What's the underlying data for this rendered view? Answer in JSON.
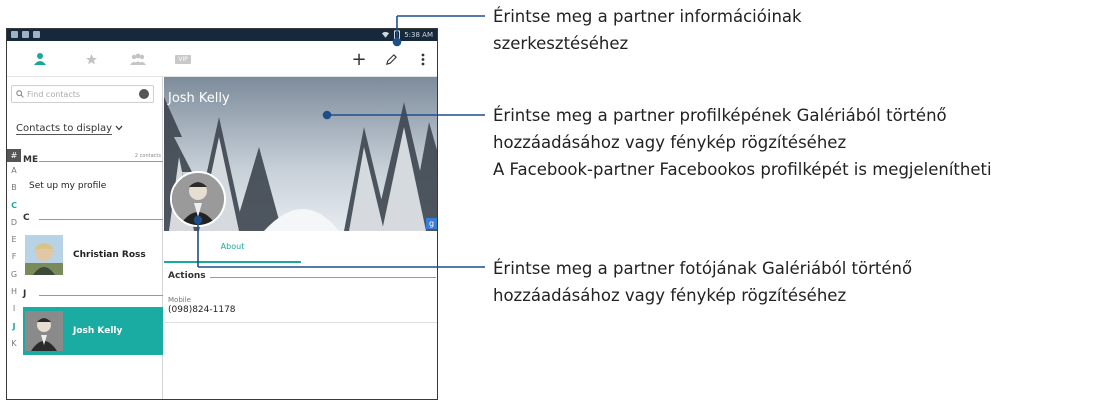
{
  "status_bar": {
    "time": "5:38 AM"
  },
  "toolbar": {
    "tabs": [
      {
        "icon": "person-icon",
        "selected": true
      },
      {
        "icon": "star-icon",
        "selected": false
      },
      {
        "icon": "group-icon",
        "selected": false
      },
      {
        "icon": "vip-icon",
        "label": "VIP",
        "selected": false
      }
    ],
    "add_label": "+",
    "accent_color": "#1aa7a0"
  },
  "left_pane": {
    "search_placeholder": "Find contacts",
    "contacts_to_display": "Contacts to display",
    "index_letters": [
      "#",
      "A",
      "B",
      "C",
      "D",
      "E",
      "F",
      "G",
      "H",
      "I",
      "J",
      "K"
    ],
    "highlighted_letters": [
      "C",
      "J"
    ],
    "sections": [
      {
        "letter": "ME",
        "count_label": "2 contacts"
      },
      {
        "letter": "C"
      },
      {
        "letter": "J"
      }
    ],
    "items": [
      {
        "name": "Set up my profile"
      },
      {
        "name": "Christian Ross"
      },
      {
        "name": "Josh Kelly",
        "selected": true
      }
    ]
  },
  "detail": {
    "contact_name": "Josh Kelly",
    "tab_about": "About",
    "actions_title": "Actions",
    "phone_label": "Mobile",
    "phone_value": "(098)824-1178",
    "source_badge": "g"
  },
  "callouts": {
    "edit": {
      "line1": "Érintse meg a partner információinak",
      "line2": "szerkesztéséhez"
    },
    "cover": {
      "line1": "Érintse meg a partner profilképének Galériából történő",
      "line2": "hozzáadásához vagy fénykép rögzítéséhez",
      "line3": "A Facebook-partner Facebookos profilképét is megjelenítheti"
    },
    "photo": {
      "line1": "Érintse meg a partner fotójának Galériából történő",
      "line2": "hozzáadásához vagy fénykép rögzítéséhez"
    }
  }
}
